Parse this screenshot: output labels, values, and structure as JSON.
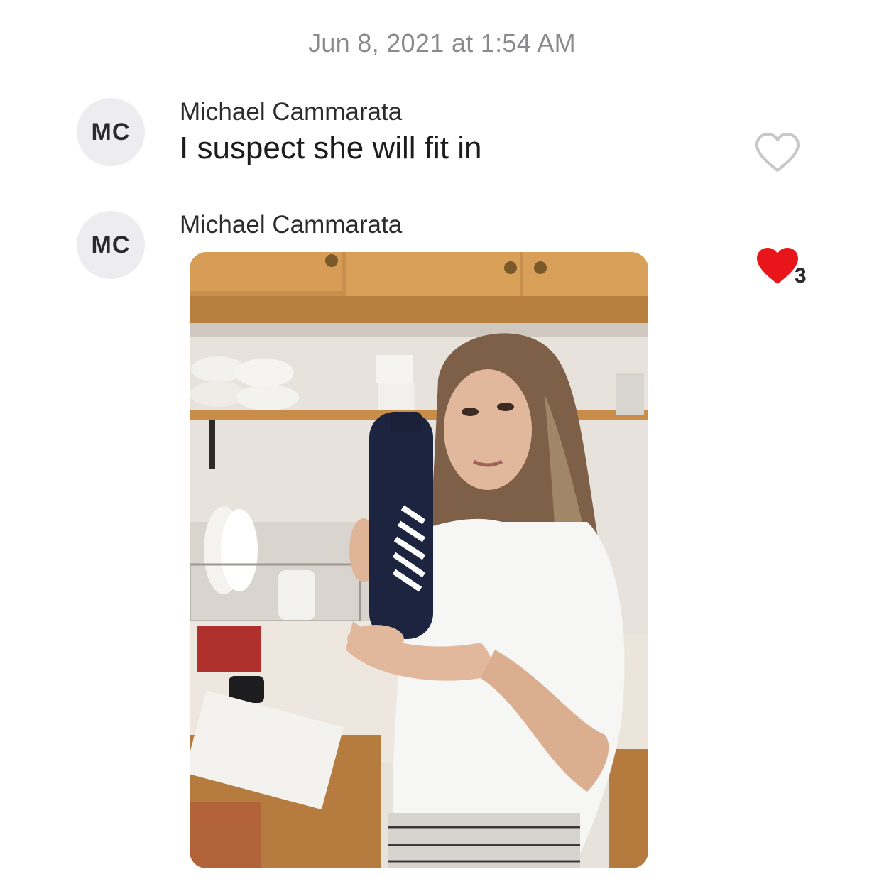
{
  "thread": {
    "timestamp": "Jun 8, 2021 at 1:54 AM"
  },
  "messages": [
    {
      "avatar_initials": "MC",
      "sender": "Michael Cammarata",
      "text": "I suspect she will fit in",
      "reaction": {
        "icon": "heart-outline-icon",
        "liked": false
      }
    },
    {
      "avatar_initials": "MC",
      "sender": "Michael Cammarata",
      "attachment": "photo",
      "reaction": {
        "icon": "heart-filled-icon",
        "liked": true,
        "count": "3",
        "color": "#e8161b"
      }
    }
  ],
  "colors": {
    "background": "#ffffff",
    "timestamp": "#8a8a8e",
    "avatar_bg": "#ededef",
    "heart_red": "#e8161b",
    "heart_outline": "#c7c7cc"
  }
}
